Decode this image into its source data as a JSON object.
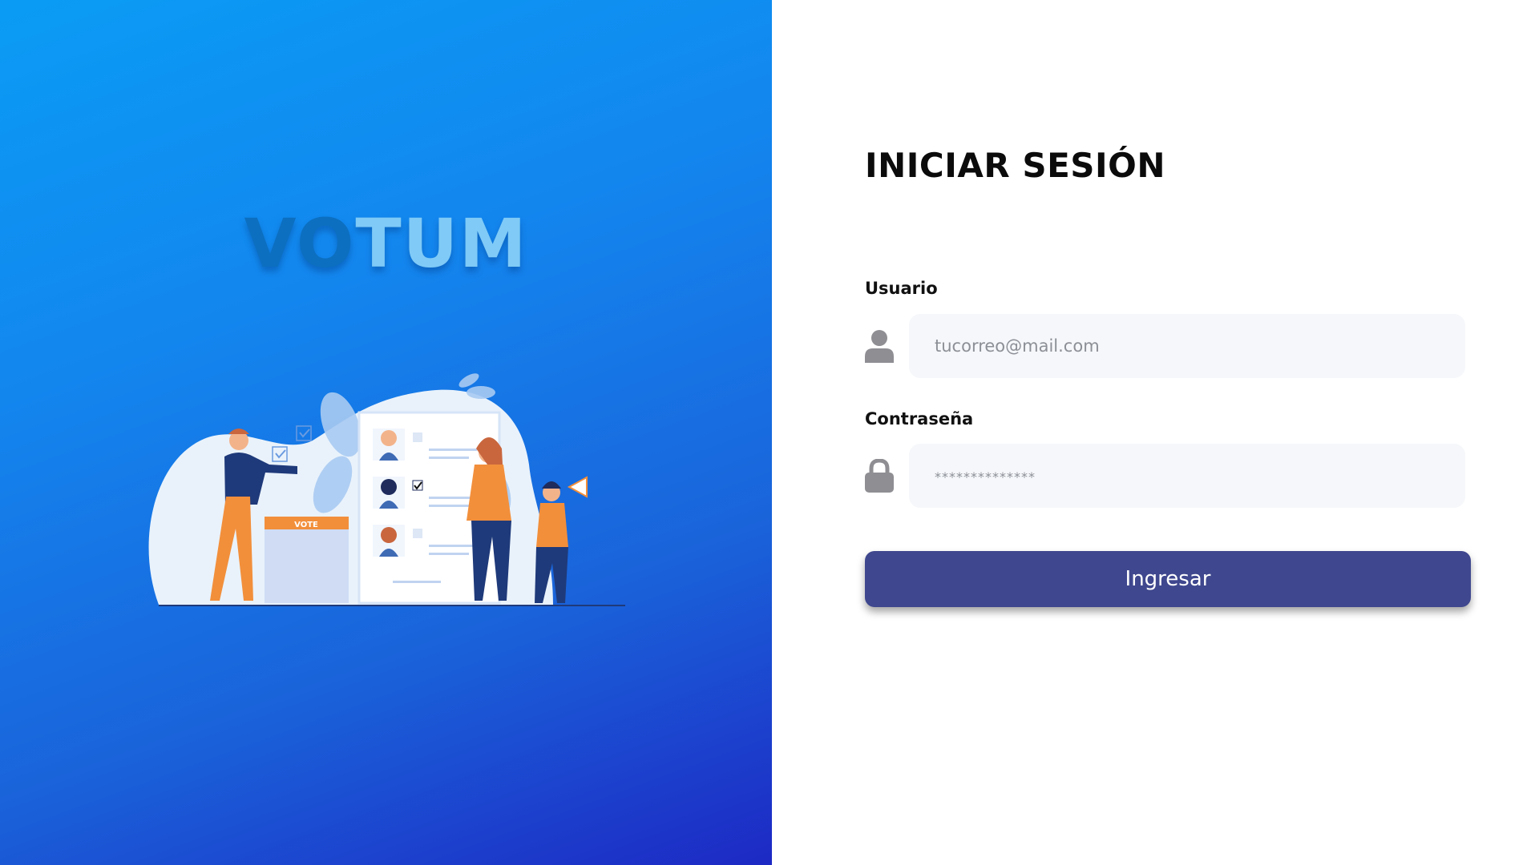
{
  "brand": {
    "name_part_a": "VO",
    "name_part_b": "TUM",
    "illustration_icon": "voting-illustration-icon",
    "ballot_box_label": "VOTE"
  },
  "login": {
    "title": "INICIAR SESIÓN",
    "user_label": "Usuario",
    "user_placeholder": "tucorreo@mail.com",
    "user_icon": "user-icon",
    "password_label": "Contraseña",
    "password_placeholder": "**************",
    "password_icon": "lock-icon",
    "submit_label": "Ingresar"
  },
  "colors": {
    "panel_gradient_start": "#0a9cf5",
    "panel_gradient_end": "#1d29c4",
    "logo_dark": "#0c6fc0",
    "logo_light": "#7fcaf7",
    "button": "#3f478e",
    "input_bg": "#f5f7fa",
    "icon_gray": "#8e8e93"
  }
}
